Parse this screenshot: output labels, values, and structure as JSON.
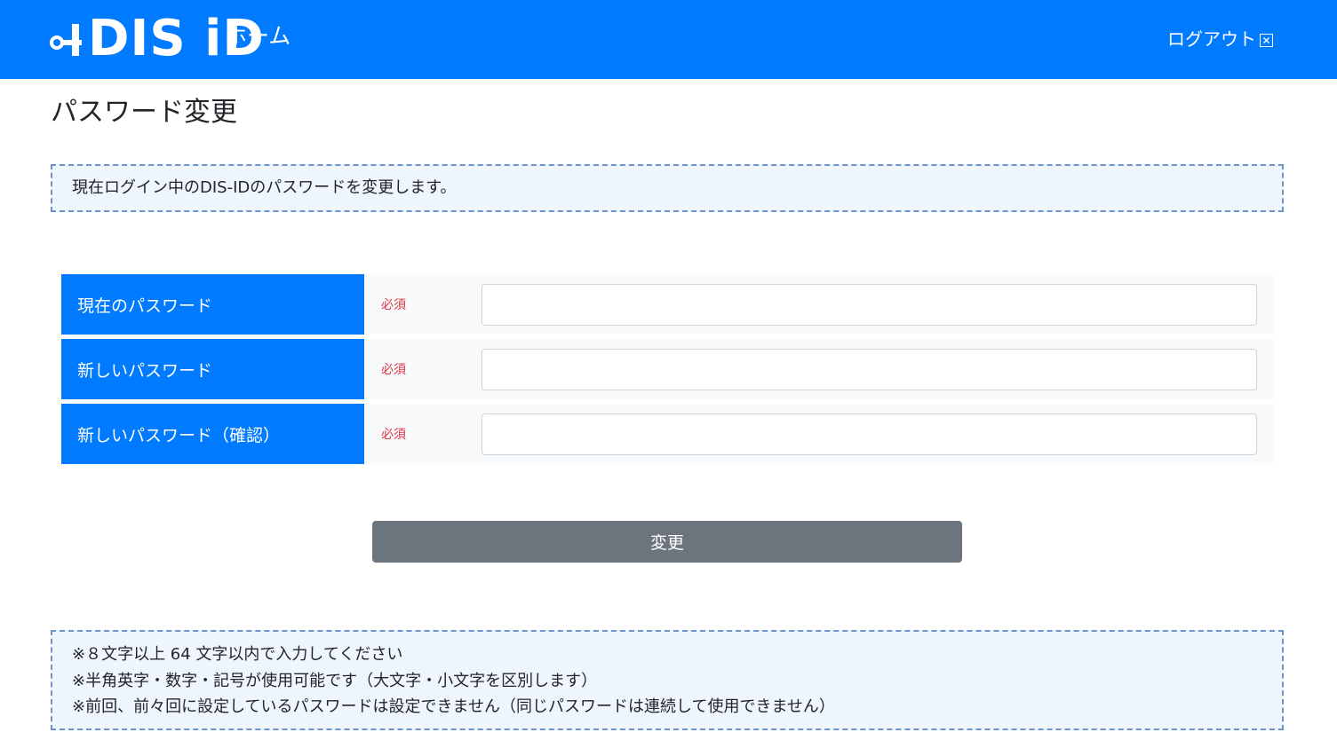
{
  "navbar": {
    "logo_text": "DIS iD",
    "home_label": "ホーム",
    "logout_label": "ログアウト",
    "brand_color": "#007bff"
  },
  "page": {
    "title": "パスワード変更",
    "description": "現在ログイン中のDIS-IDのパスワードを変更します。"
  },
  "form": {
    "fields": [
      {
        "label": "現在のパスワード",
        "required": "必須",
        "value": ""
      },
      {
        "label": "新しいパスワード",
        "required": "必須",
        "value": ""
      },
      {
        "label": "新しいパスワード（確認）",
        "required": "必須",
        "value": ""
      }
    ],
    "submit_label": "変更"
  },
  "notes": {
    "lines": [
      "※８文字以上 64 文字以内で入力してください",
      "※半角英字・数字・記号が使用可能です（大文字・小文字を区別します）",
      "※前回、前々回に設定しているパスワードは設定できません（同じパスワードは連続して使用できません）"
    ]
  },
  "icons": {
    "logo": "key-icon",
    "logout": "close-square-icon"
  }
}
